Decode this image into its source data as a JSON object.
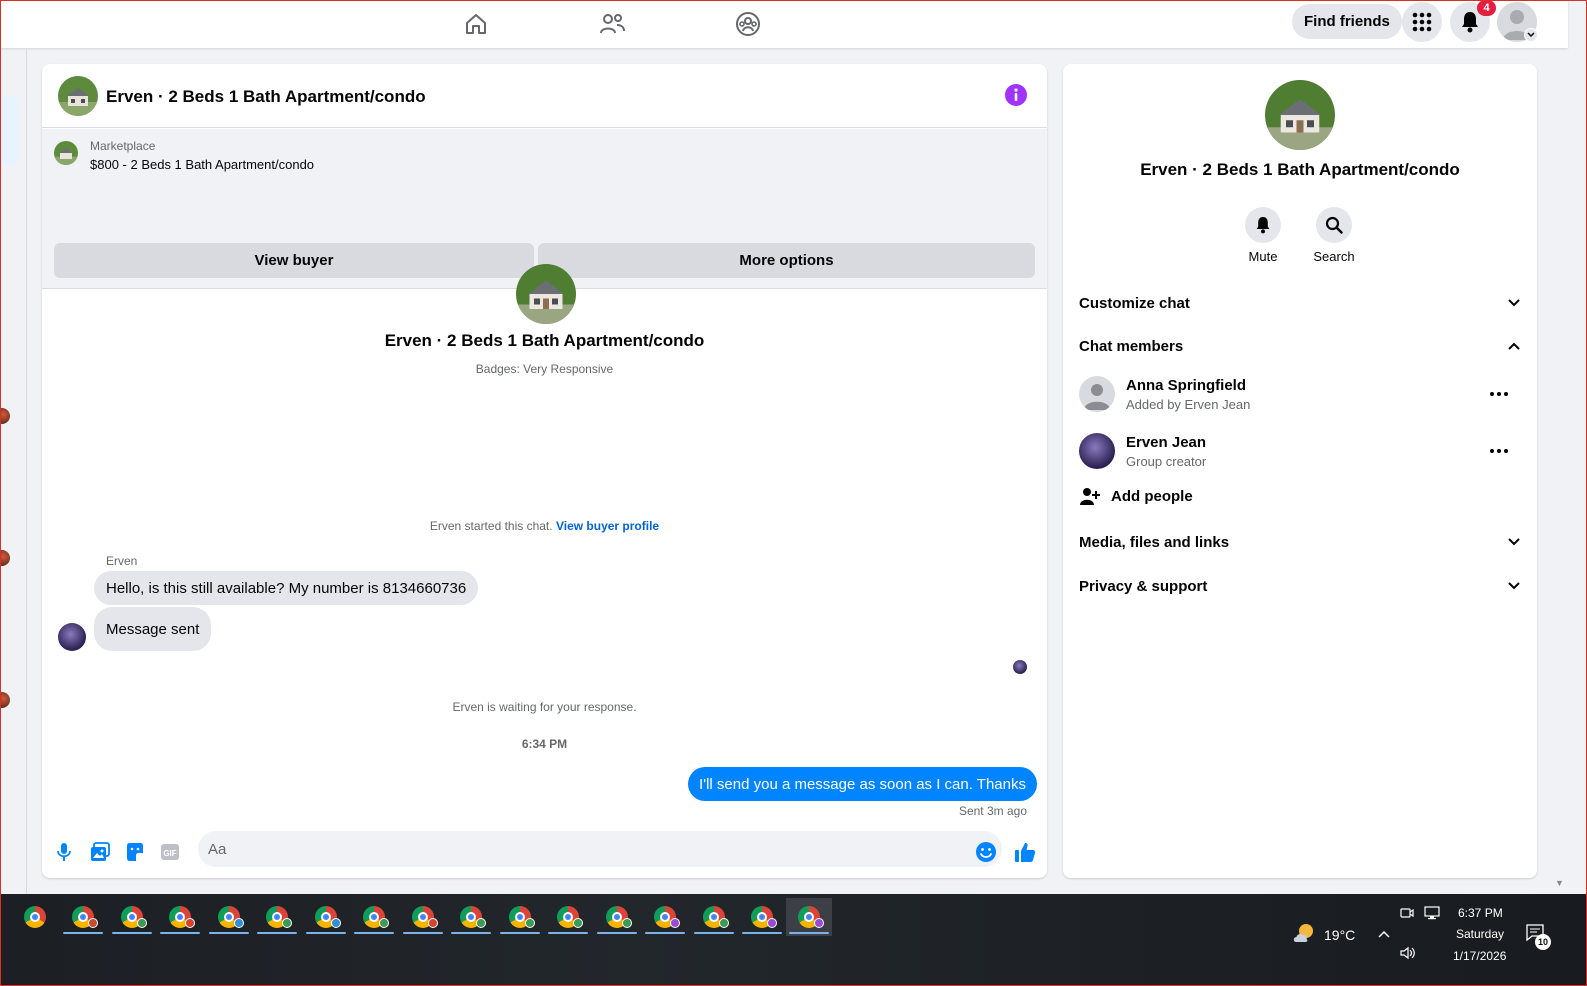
{
  "topnav": {
    "icons": [
      "home-icon",
      "friends-icon",
      "groups-icon"
    ],
    "find_friends": "Find friends",
    "notification_count": "4"
  },
  "chat": {
    "title": "Erven · 2 Beds 1 Bath Apartment/condo",
    "marketplace_label": "Marketplace",
    "listing": "$800 - 2 Beds 1 Bath Apartment/condo",
    "view_buyer": "View buyer",
    "more_options": "More options",
    "center_title": "Erven · 2 Beds 1 Bath Apartment/condo",
    "badges": "Badges: Very Responsive",
    "started_text": "Erven started this chat.",
    "view_buyer_profile": "View buyer profile",
    "sender": "Erven",
    "messages_in": [
      "Hello, is this still available? My number is 8134660736",
      "Message sent"
    ],
    "waiting": "Erven is waiting for your response.",
    "timestamp": "6:34 PM",
    "message_out": "I'll send you a message as soon as I can. Thanks",
    "sent_status": "Sent 3m ago",
    "input_placeholder": "Aa"
  },
  "side": {
    "title": "Erven · 2 Beds 1 Bath Apartment/condo",
    "mute": "Mute",
    "search": "Search",
    "customize_chat": "Customize chat",
    "chat_members": "Chat members",
    "members": [
      {
        "name": "Anna Springfield",
        "sub": "Added by Erven Jean"
      },
      {
        "name": "Erven Jean",
        "sub": "Group creator"
      }
    ],
    "add_people": "Add people",
    "media": "Media, files and links",
    "privacy": "Privacy & support"
  },
  "taskbar": {
    "temperature": "19°C",
    "time": "6:37 PM",
    "day": "Saturday",
    "date": "1/17/2026",
    "notification_count": "10"
  },
  "colors": {
    "accent_blue": "#0084ff",
    "info_purple": "#a033ff",
    "badge_red": "#e41e3f"
  }
}
